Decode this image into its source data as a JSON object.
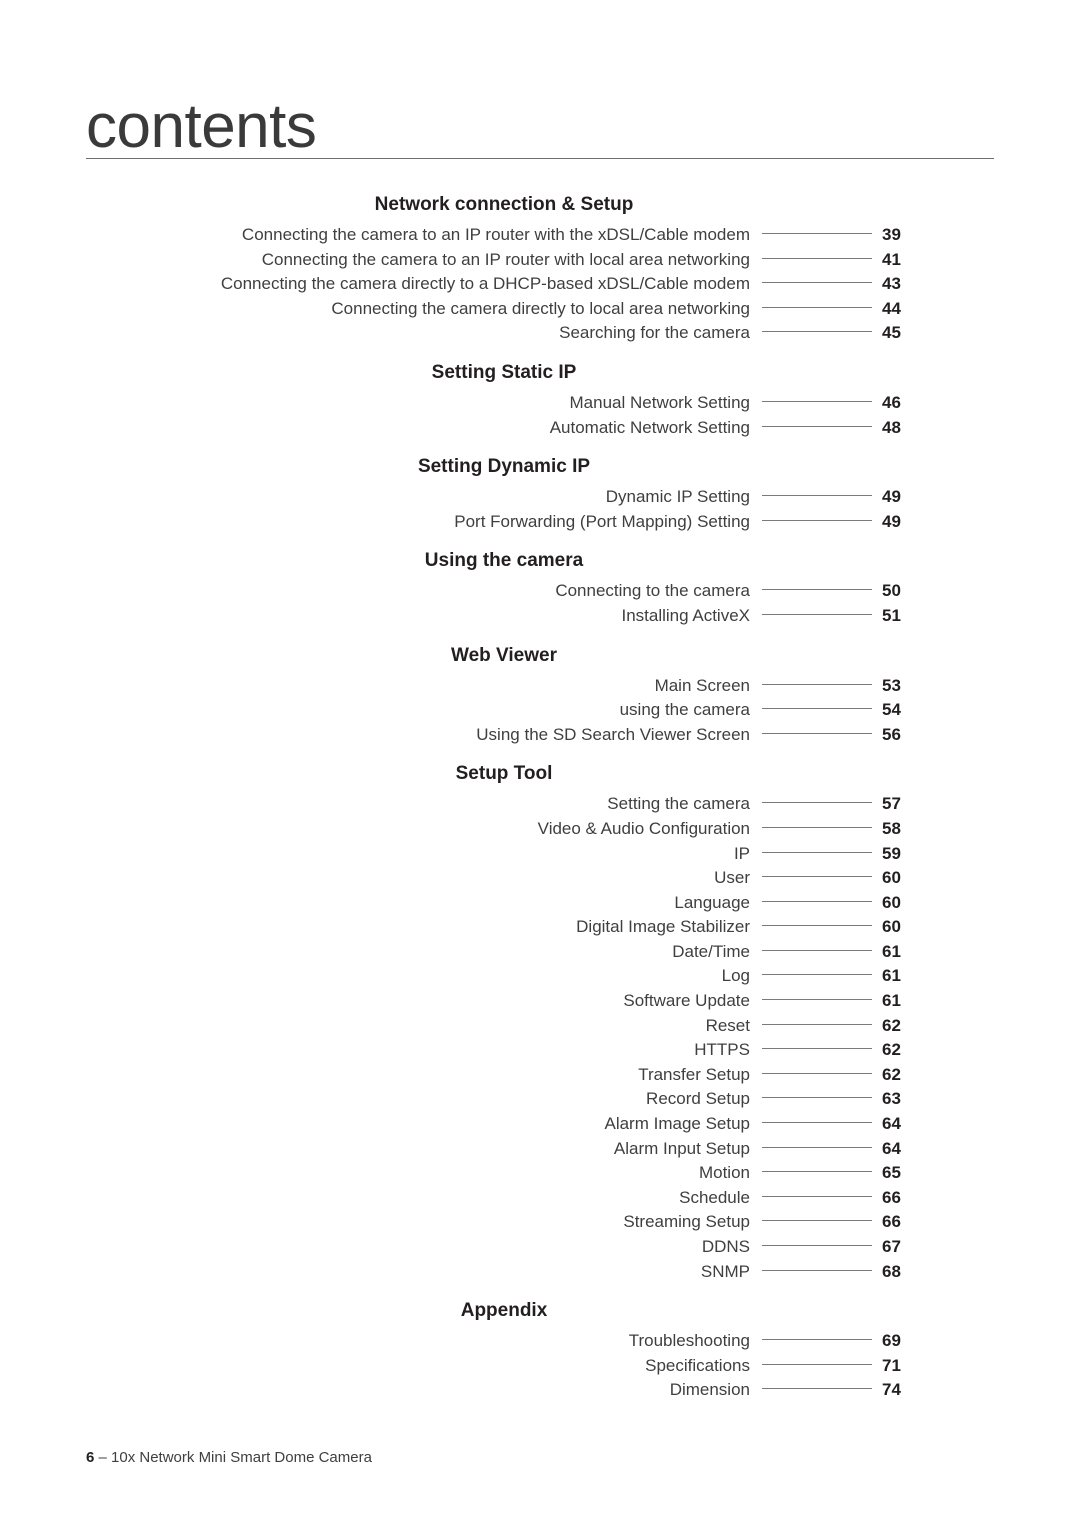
{
  "header": {
    "title": "contents"
  },
  "sections": [
    {
      "title": "Network connection & Setup",
      "entries": [
        {
          "label": "Connecting the camera to an IP router with the xDSL/Cable modem",
          "page": "39"
        },
        {
          "label": "Connecting the camera to an IP router with local area networking",
          "page": "41"
        },
        {
          "label": "Connecting the camera directly to a DHCP-based xDSL/Cable modem",
          "page": "43"
        },
        {
          "label": "Connecting the camera directly to local area networking",
          "page": "44"
        },
        {
          "label": "Searching for the camera",
          "page": "45"
        }
      ]
    },
    {
      "title": "Setting Static IP",
      "entries": [
        {
          "label": "Manual Network Setting",
          "page": "46"
        },
        {
          "label": "Automatic Network Setting",
          "page": "48"
        }
      ]
    },
    {
      "title": "Setting Dynamic IP",
      "entries": [
        {
          "label": "Dynamic IP Setting",
          "page": "49"
        },
        {
          "label": "Port Forwarding (Port Mapping) Setting",
          "page": "49"
        }
      ]
    },
    {
      "title": "Using the camera",
      "entries": [
        {
          "label": "Connecting to the camera",
          "page": "50"
        },
        {
          "label": "Installing ActiveX",
          "page": "51"
        }
      ]
    },
    {
      "title": "Web Viewer",
      "entries": [
        {
          "label": "Main Screen",
          "page": "53"
        },
        {
          "label": "using the camera",
          "page": "54"
        },
        {
          "label": "Using the SD Search Viewer Screen",
          "page": "56"
        }
      ]
    },
    {
      "title": "Setup Tool",
      "entries": [
        {
          "label": "Setting the camera",
          "page": "57"
        },
        {
          "label": "Video & Audio Configuration",
          "page": "58"
        },
        {
          "label": "IP",
          "page": "59"
        },
        {
          "label": "User",
          "page": "60"
        },
        {
          "label": "Language",
          "page": "60"
        },
        {
          "label": "Digital Image Stabilizer",
          "page": "60"
        },
        {
          "label": "Date/Time",
          "page": "61"
        },
        {
          "label": "Log",
          "page": "61"
        },
        {
          "label": "Software Update",
          "page": "61"
        },
        {
          "label": "Reset",
          "page": "62"
        },
        {
          "label": "HTTPS",
          "page": "62"
        },
        {
          "label": "Transfer Setup",
          "page": "62"
        },
        {
          "label": "Record Setup",
          "page": "63"
        },
        {
          "label": "Alarm Image Setup",
          "page": "64"
        },
        {
          "label": "Alarm Input Setup",
          "page": "64"
        },
        {
          "label": "Motion",
          "page": "65"
        },
        {
          "label": "Schedule",
          "page": "66"
        },
        {
          "label": "Streaming Setup",
          "page": "66"
        },
        {
          "label": "DDNS",
          "page": "67"
        },
        {
          "label": "SNMP",
          "page": "68"
        }
      ]
    },
    {
      "title": "Appendix",
      "entries": [
        {
          "label": "Troubleshooting",
          "page": "69"
        },
        {
          "label": "Specifications",
          "page": "71"
        },
        {
          "label": "Dimension",
          "page": "74"
        }
      ]
    }
  ],
  "footer": {
    "page_number": "6",
    "separator": "–",
    "product": "10x Network Mini Smart Dome Camera"
  }
}
